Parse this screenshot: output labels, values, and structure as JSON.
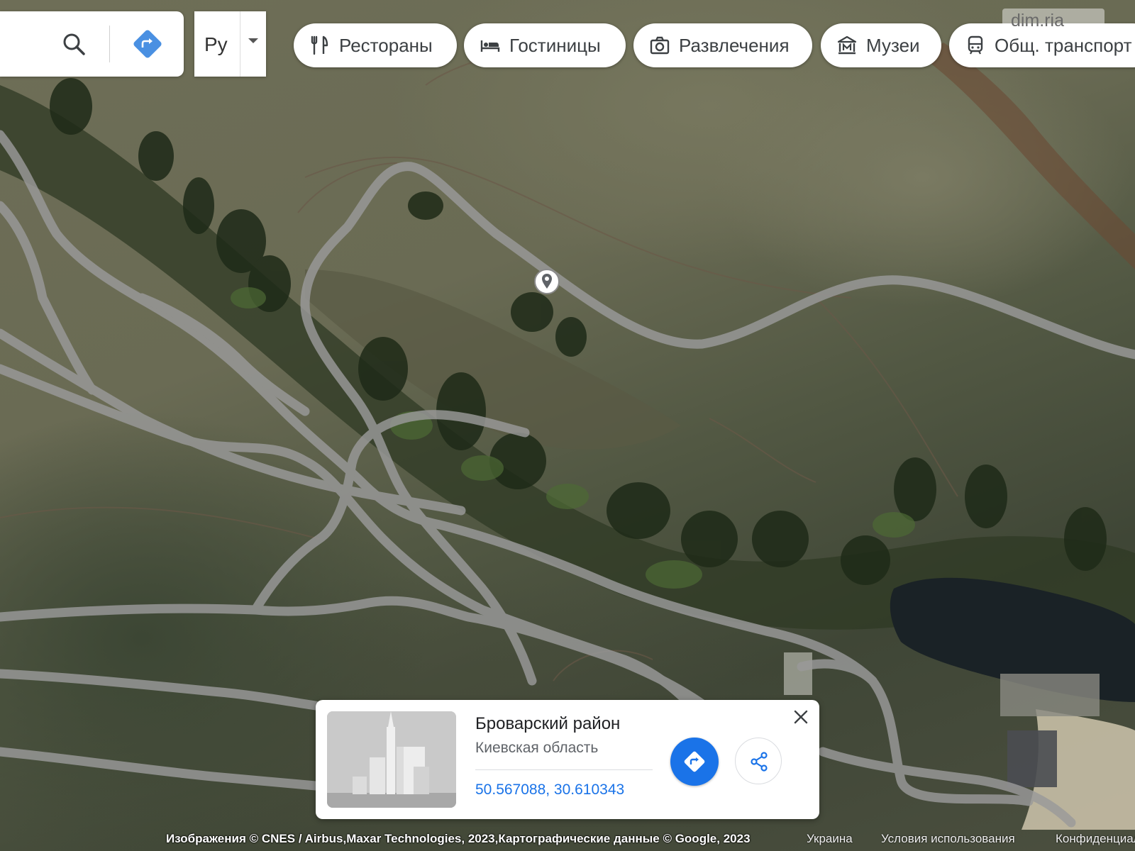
{
  "toolbar": {
    "language_label": "Ру"
  },
  "categories": [
    {
      "label": "Рестораны",
      "icon": "restaurant-icon"
    },
    {
      "label": "Гостиницы",
      "icon": "hotel-icon"
    },
    {
      "label": "Развлечения",
      "icon": "camera-icon"
    },
    {
      "label": "Музеи",
      "icon": "museum-icon"
    },
    {
      "label": "Общ. транспорт",
      "icon": "transit-icon"
    }
  ],
  "watermark": "dim.ria",
  "place_card": {
    "title": "Броварский район",
    "subtitle": "Киевская область",
    "coordinates": "50.567088, 30.610343"
  },
  "footer": {
    "attribution": "Изображения © CNES / Airbus,Maxar Technologies, 2023,Картографические данные © Google, 2023",
    "country": "Украина",
    "terms": "Условия использования",
    "privacy": "Конфиденциальность"
  },
  "colors": {
    "accent": "#1a73e8",
    "route_gray": "#9a9a9a",
    "water": "#1a2226"
  }
}
